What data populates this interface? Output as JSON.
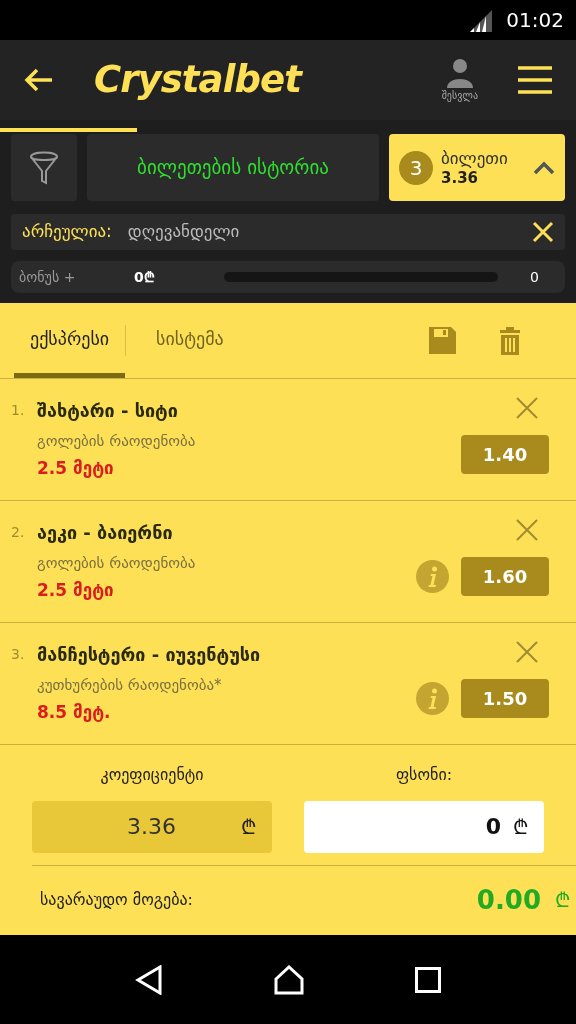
{
  "status_bar": {
    "time": "01:02"
  },
  "header": {
    "logo": "Crystalbet",
    "profile_label": "შესვლა"
  },
  "toolbar": {
    "history_button": "ბილეთების ისტორია",
    "ticket": {
      "count": "3",
      "label": "ბილეთი",
      "odds": "3.36",
      "expanded": true
    }
  },
  "filter": {
    "label": "არჩეულია:",
    "value": "დღევანდელი"
  },
  "bonus": {
    "label": "ბონუს +",
    "amount": "0₾",
    "level": 0,
    "target": "0"
  },
  "tabs": [
    {
      "label": "ექსპრესი",
      "selected": true
    },
    {
      "label": "სისტემა",
      "selected": false
    }
  ],
  "bets": [
    {
      "number": "1.",
      "match": "შახტარი - სიტი",
      "market": "გოლების რაოდენობა",
      "line": "2.5 მეტი",
      "odds": "1.40",
      "info": false
    },
    {
      "number": "2.",
      "match": "აეკი - ბაიერნი",
      "market": "გოლების რაოდენობა",
      "line": "2.5 მეტი",
      "odds": "1.60",
      "info": true
    },
    {
      "number": "3.",
      "match": "მანჩესტერი - იუვენტუსი",
      "market": "კუთხურების რაოდენობა*",
      "line": "8.5 მეტ.",
      "odds": "1.50",
      "info": true
    }
  ],
  "totals": {
    "odds_label": "კოეფიციენტი",
    "odds_value": "3.36",
    "odds_currency": "₾",
    "stake_label": "ფსონი:",
    "stake_value": "0",
    "stake_currency": "₾",
    "win_label": "სავარაუდო მოგება:",
    "win_value": "0.00",
    "win_currency": "₾"
  }
}
